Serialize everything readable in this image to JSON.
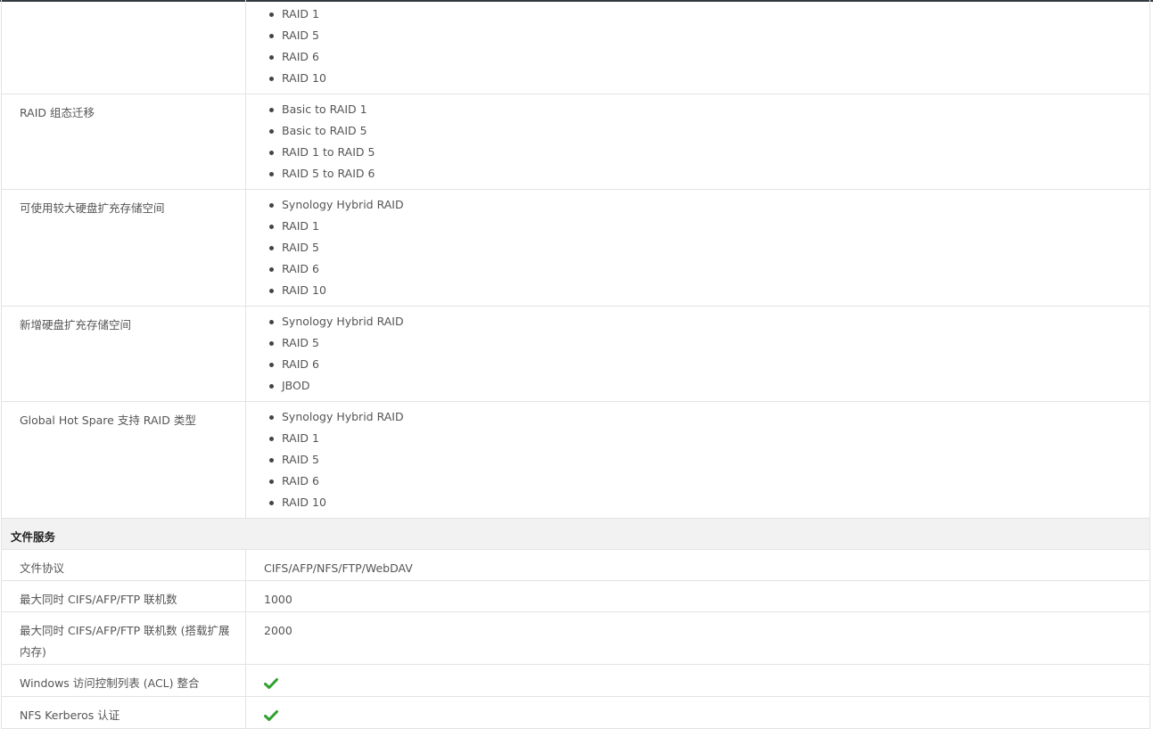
{
  "rows_top": [
    {
      "label": "",
      "options": [
        "RAID 1",
        "RAID 5",
        "RAID 6",
        "RAID 10"
      ]
    },
    {
      "label": "RAID 组态迁移",
      "options": [
        "Basic to RAID 1",
        "Basic to RAID 5",
        "RAID 1 to RAID 5",
        "RAID 5 to RAID 6"
      ]
    },
    {
      "label": "可使用较大硬盘扩充存储空间",
      "options": [
        "Synology Hybrid RAID",
        "RAID 1",
        "RAID 5",
        "RAID 6",
        "RAID 10"
      ]
    },
    {
      "label": "新增硬盘扩充存储空间",
      "options": [
        "Synology Hybrid RAID",
        "RAID 5",
        "RAID 6",
        "JBOD"
      ]
    },
    {
      "label": "Global Hot Spare 支持 RAID 类型",
      "options": [
        "Synology Hybrid RAID",
        "RAID 1",
        "RAID 5",
        "RAID 6",
        "RAID 10"
      ]
    }
  ],
  "section": {
    "title": "文件服务"
  },
  "rows_file": [
    {
      "label": "文件协议",
      "value": "CIFS/AFP/NFS/FTP/WebDAV"
    },
    {
      "label": "最大同时 CIFS/AFP/FTP 联机数",
      "value": "1000"
    },
    {
      "label": "最大同时 CIFS/AFP/FTP 联机数 (搭载扩展内存)",
      "value": "2000"
    },
    {
      "label": "Windows 访问控制列表 (ACL) 整合",
      "value_icon": "checkmark-icon"
    },
    {
      "label": "NFS Kerberos 认证",
      "value_icon": "checkmark-icon"
    }
  ],
  "colors": {
    "check": "#2ea12e",
    "section_bg": "#f2f2f2",
    "border": "#e3e3e3",
    "text": "#555555"
  }
}
